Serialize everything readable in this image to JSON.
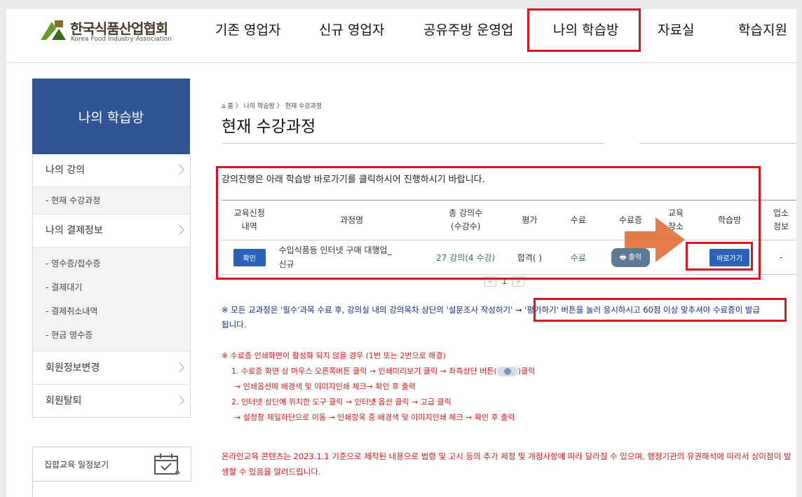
{
  "header": {
    "logo_ko": "한국식품산업협회",
    "logo_en": "Korea Food Industry Association",
    "nav": [
      "기존 영업자",
      "신규 영업자",
      "공유주방 운영업",
      "나의 학습방",
      "자료실",
      "학습지원"
    ]
  },
  "sidebar": {
    "title": "나의 학습방",
    "menu": [
      {
        "label": "나의 강의",
        "subs": [
          "- 현재 수강과정"
        ]
      },
      {
        "label": "나의 결제정보",
        "subs": [
          "- 영수증/접수증",
          "- 결제대기",
          "- 결제취소내역",
          "- 현금 영수증"
        ]
      },
      {
        "label": "회원정보변경",
        "subs": []
      },
      {
        "label": "회원탈퇴",
        "subs": []
      }
    ],
    "schedule_label": "집합교육 일정보기"
  },
  "content": {
    "breadcrumb": [
      "홈",
      "나의 학습방",
      "현재 수강과정"
    ],
    "title": "현재 수강과정",
    "intro": "강의진행은 아래 학습방 바로가기를 클릭하시어 진행하시기 바랍니다.",
    "table": {
      "headers": [
        "교육신청\n내역",
        "과정명",
        "총 강의수\n(수강수)",
        "평가",
        "수료",
        "수료증",
        "교육\n장소",
        "학습방",
        "업소\n정보"
      ],
      "row": {
        "confirm_btn": "확인",
        "course": "수입식품등 인터넷 구매 대행업_\n신규",
        "lectures": "27 강의(4 수강)",
        "evaluation": "합격(  )",
        "completion": "수료",
        "print_btn": "🖶 출력",
        "place": "",
        "go_btn": "바로가기",
        "shop": "-"
      }
    },
    "pagination": {
      "prev": "<",
      "page": "1",
      "next": ">"
    },
    "notice_blue_1": "※ 모든 교과정은 '필수'과목 수료 후, 강의실 내의 강의목차 상단의 '설문조사 작성하기' → ",
    "notice_blue_2": "'평가하기' 버튼을 눌러 응시하시고 60점 이상 맞추셔야 수료증이 발급",
    "notice_blue_3": "됩니다.",
    "notice_red": [
      "※ 수료증 인쇄화면이 활성화 되지 않을 경우 (1번 또는 2번으로 해결)",
      "1. 수료증 화면 상 마우스 오른쪽버튼 클릭 → 인쇄미리보기 클릭 → 좌측상단 버튼(",
      ")클릭",
      "→ 인쇄옵션에 배경색 및 이미지인쇄 체크→ 확인 후 출력",
      "2. 인터넷 상단에 위치한 도구 클릭 → 인터넷 옵션 클릭 → 고급 클릭",
      "→ 설정창 제일하단으로 이동 → 인쇄항목 중 배경색 및 이미지인쇄 체크 → 확인 후 출력"
    ],
    "notice_final": "온라인교육 콘텐츠는 2023.1.1 기준으로 제작된 내용으로 법령 및 고시 등의 추가 제정 및 개정사항에 따라 달라질 수 있으며, 행정기관의 유권해석에 따라서 상이점이 발생할 수 있음을 알려드립니다."
  },
  "colors": {
    "brand_blue": "#2f5594",
    "highlight_red": "#d8141d",
    "arrow_orange": "#e2703a",
    "notice_blue": "#0b2a8a",
    "notice_red": "#d51717"
  }
}
